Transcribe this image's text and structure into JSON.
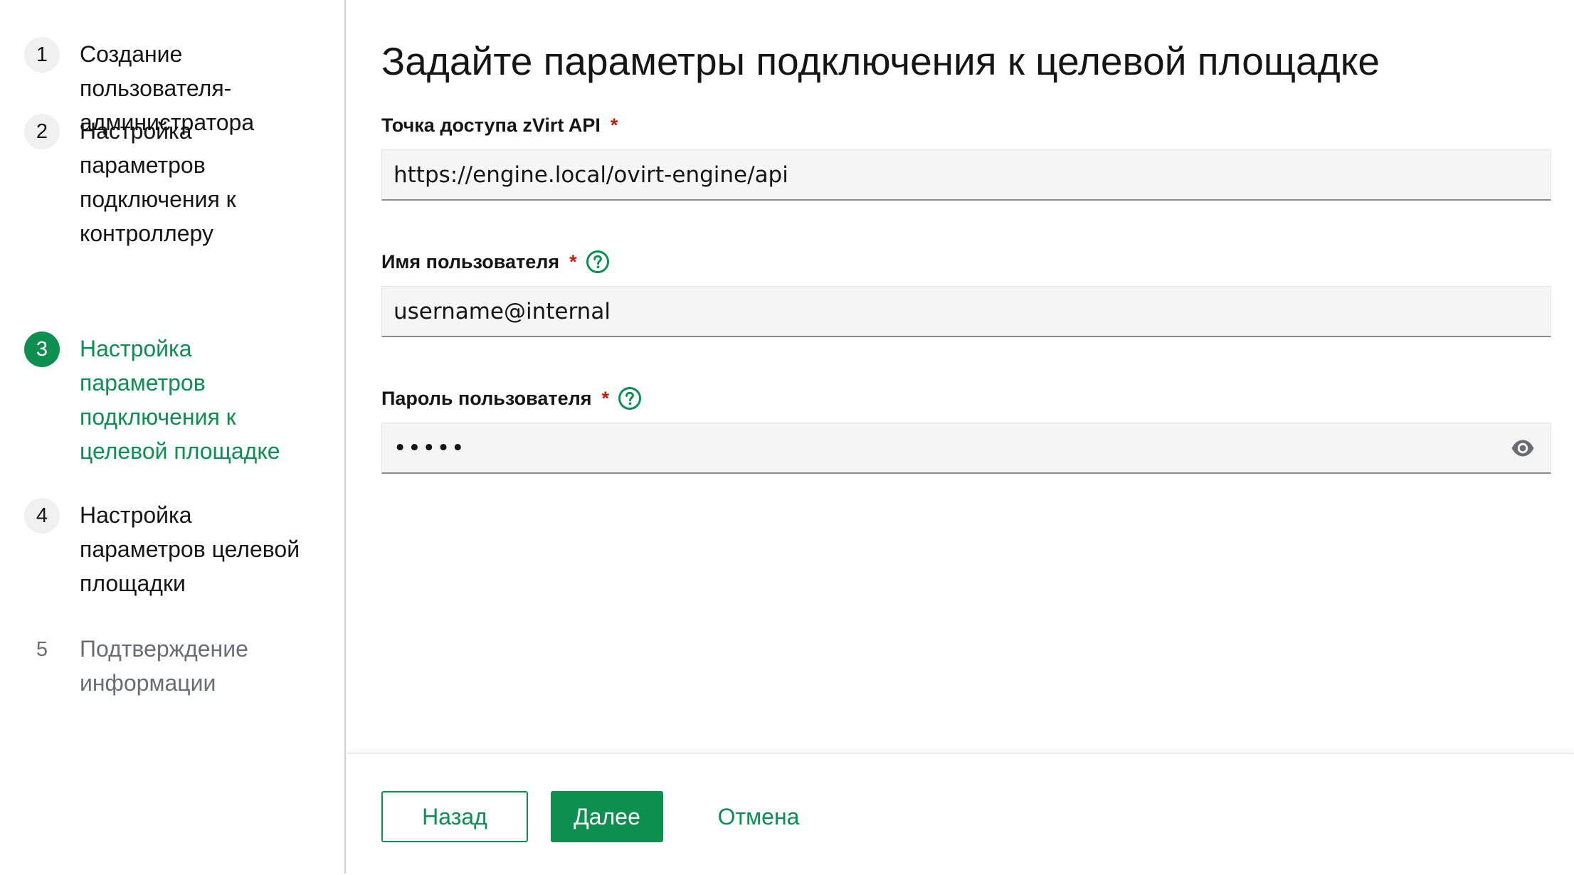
{
  "colors": {
    "accent": "#0c8f4f",
    "required": "#c9190b",
    "text": "#151515",
    "muted": "#6a6e73"
  },
  "sidebar": {
    "steps": [
      {
        "number": "1",
        "label": "Создание пользователя-администратора",
        "state": "completed"
      },
      {
        "number": "2",
        "label": "Настройка параметров подключения к контроллеру",
        "state": "completed"
      },
      {
        "number": "3",
        "label": "Настройка параметров подключения к целевой площадке",
        "state": "current"
      },
      {
        "number": "4",
        "label": "Настройка параметров целевой площадки",
        "state": "completed"
      },
      {
        "number": "5",
        "label": "Подтверждение информации",
        "state": "disabled"
      }
    ]
  },
  "main": {
    "title": "Задайте параметры подключения к целевой площадке",
    "fields": [
      {
        "label": "Точка доступа zVirt API",
        "required_mark": "*",
        "value": "https://engine.local/ovirt-engine/api",
        "help_icon": false
      },
      {
        "label": "Имя пользователя",
        "required_mark": "*",
        "value": "username@internal",
        "help_icon": true,
        "help_icon_name": "question-circle-icon"
      },
      {
        "label": "Пароль пользователя",
        "required_mark": "*",
        "value": "•••••",
        "help_icon": true,
        "help_icon_name": "question-circle-icon",
        "toggle_icon": "eye-icon"
      }
    ]
  },
  "footer": {
    "back_label": "Назад",
    "next_label": "Далее",
    "cancel_label": "Отмена"
  }
}
